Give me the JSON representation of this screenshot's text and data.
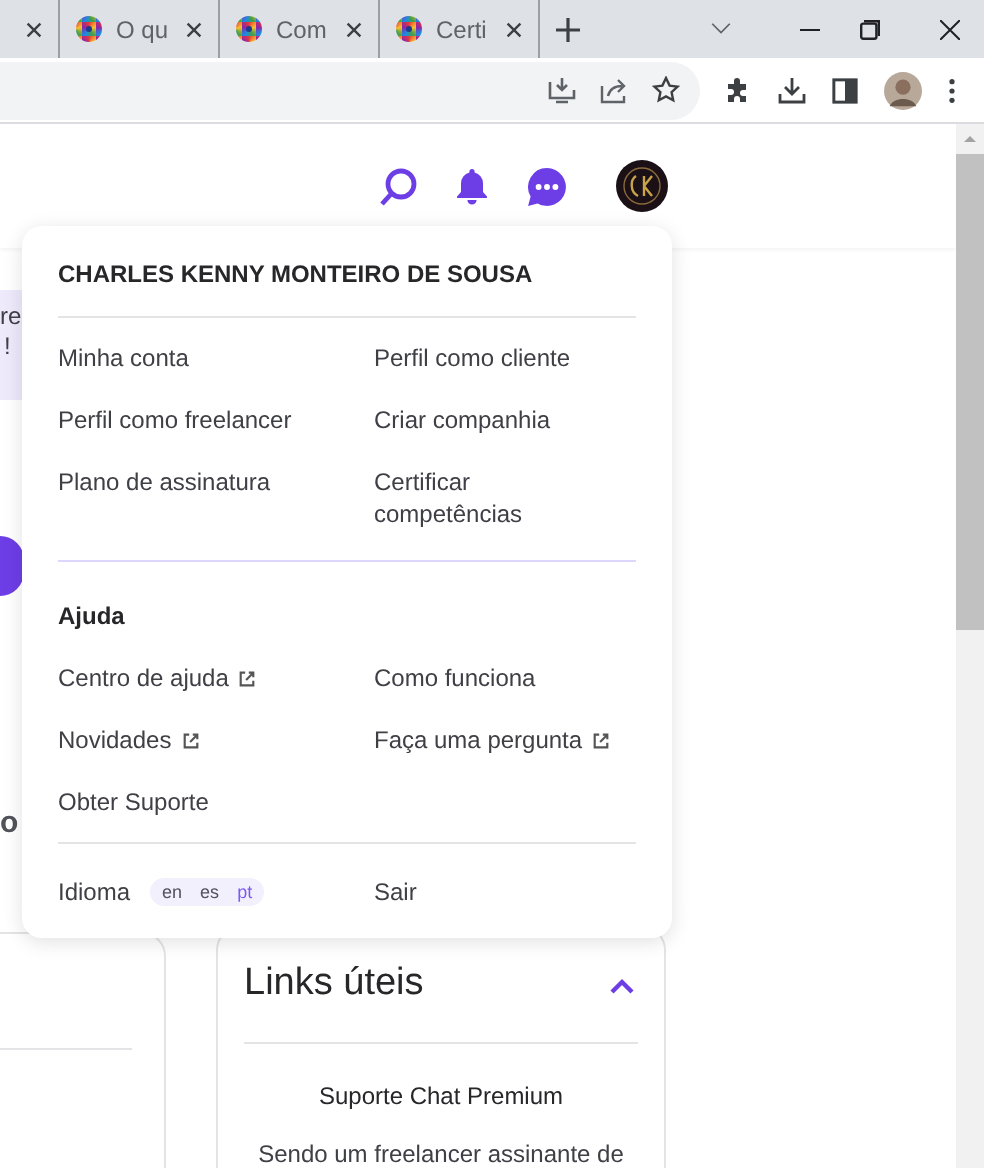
{
  "browser": {
    "tabs": [
      {
        "selected": false
      },
      {
        "title": "O qu",
        "selected": false
      },
      {
        "title": "Com",
        "selected": false
      },
      {
        "title": "Certi",
        "selected": false
      }
    ]
  },
  "page": {
    "fragments": [
      "re",
      "!",
      "o"
    ],
    "user_menu": {
      "name": "CHARLES KENNY MONTEIRO DE SOUSA",
      "account_items": [
        {
          "label": "Minha conta",
          "external": false
        },
        {
          "label": "Perfil como cliente",
          "external": false
        },
        {
          "label": "Perfil como freelancer",
          "external": false
        },
        {
          "label": "Criar companhia",
          "external": false
        },
        {
          "label": "Plano de assinatura",
          "external": false
        },
        {
          "label": "Certificar competências",
          "external": false
        }
      ],
      "help_heading": "Ajuda",
      "help_items": [
        {
          "label": "Centro de ajuda",
          "external": true
        },
        {
          "label": "Como funciona",
          "external": false
        },
        {
          "label": "Novidades",
          "external": true
        },
        {
          "label": "Faça uma pergunta",
          "external": true
        },
        {
          "label": "Obter Suporte",
          "external": false
        }
      ],
      "language_label": "Idioma",
      "languages": [
        {
          "code": "en",
          "selected": false
        },
        {
          "code": "es",
          "selected": false
        },
        {
          "code": "pt",
          "selected": true
        }
      ],
      "logout": "Sair"
    },
    "links_card": {
      "title": "Links úteis",
      "expanded": true,
      "subtitle": "Suporte Chat Premium",
      "text": "Sendo um freelancer assinante de"
    }
  }
}
